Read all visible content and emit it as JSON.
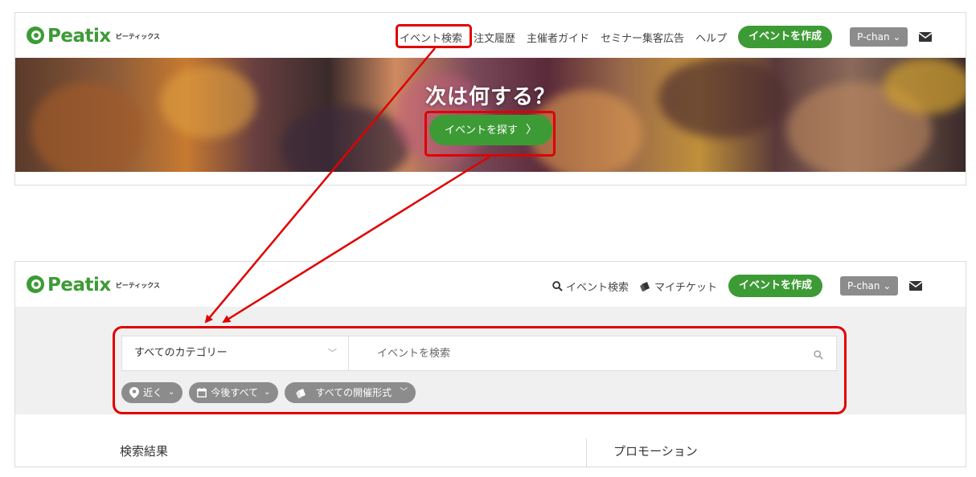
{
  "colors": {
    "brand_green": "#3d9b35",
    "annotation_red": "#e00000",
    "chip_gray": "#8c8c8c",
    "search_bg": "#f0f0f0"
  },
  "logo": {
    "text": "Peatix",
    "kana": "ピーティックス"
  },
  "top": {
    "nav": {
      "event_search": "イベント検索",
      "order_history": "注文履歴",
      "organizer_guide": "主催者ガイド",
      "seminar_ads": "セミナー集客広告",
      "help": "ヘルプ",
      "create_event": "イベントを作成",
      "user": "P-chan ⌄"
    },
    "hero": {
      "title": "次は何する？",
      "button": "イベントを探す",
      "button_icon": "chevron-right-icon"
    }
  },
  "bottom": {
    "nav": {
      "event_search": "イベント検索",
      "event_search_icon": "search-icon",
      "my_tickets": "マイチケット",
      "my_tickets_icon": "ticket-icon",
      "create_event": "イベントを作成",
      "user": "P-chan ⌄"
    },
    "search": {
      "category": "すべてのカテゴリー",
      "placeholder": "イベントを検索"
    },
    "filters": [
      {
        "label": "近く",
        "icon": "location-pin-icon"
      },
      {
        "label": "今後すべて",
        "icon": "calendar-icon"
      },
      {
        "label": "すべての開催形式",
        "icon": "ticket-icon"
      }
    ],
    "results_title": "検索結果",
    "promo_title": "プロモーション"
  }
}
